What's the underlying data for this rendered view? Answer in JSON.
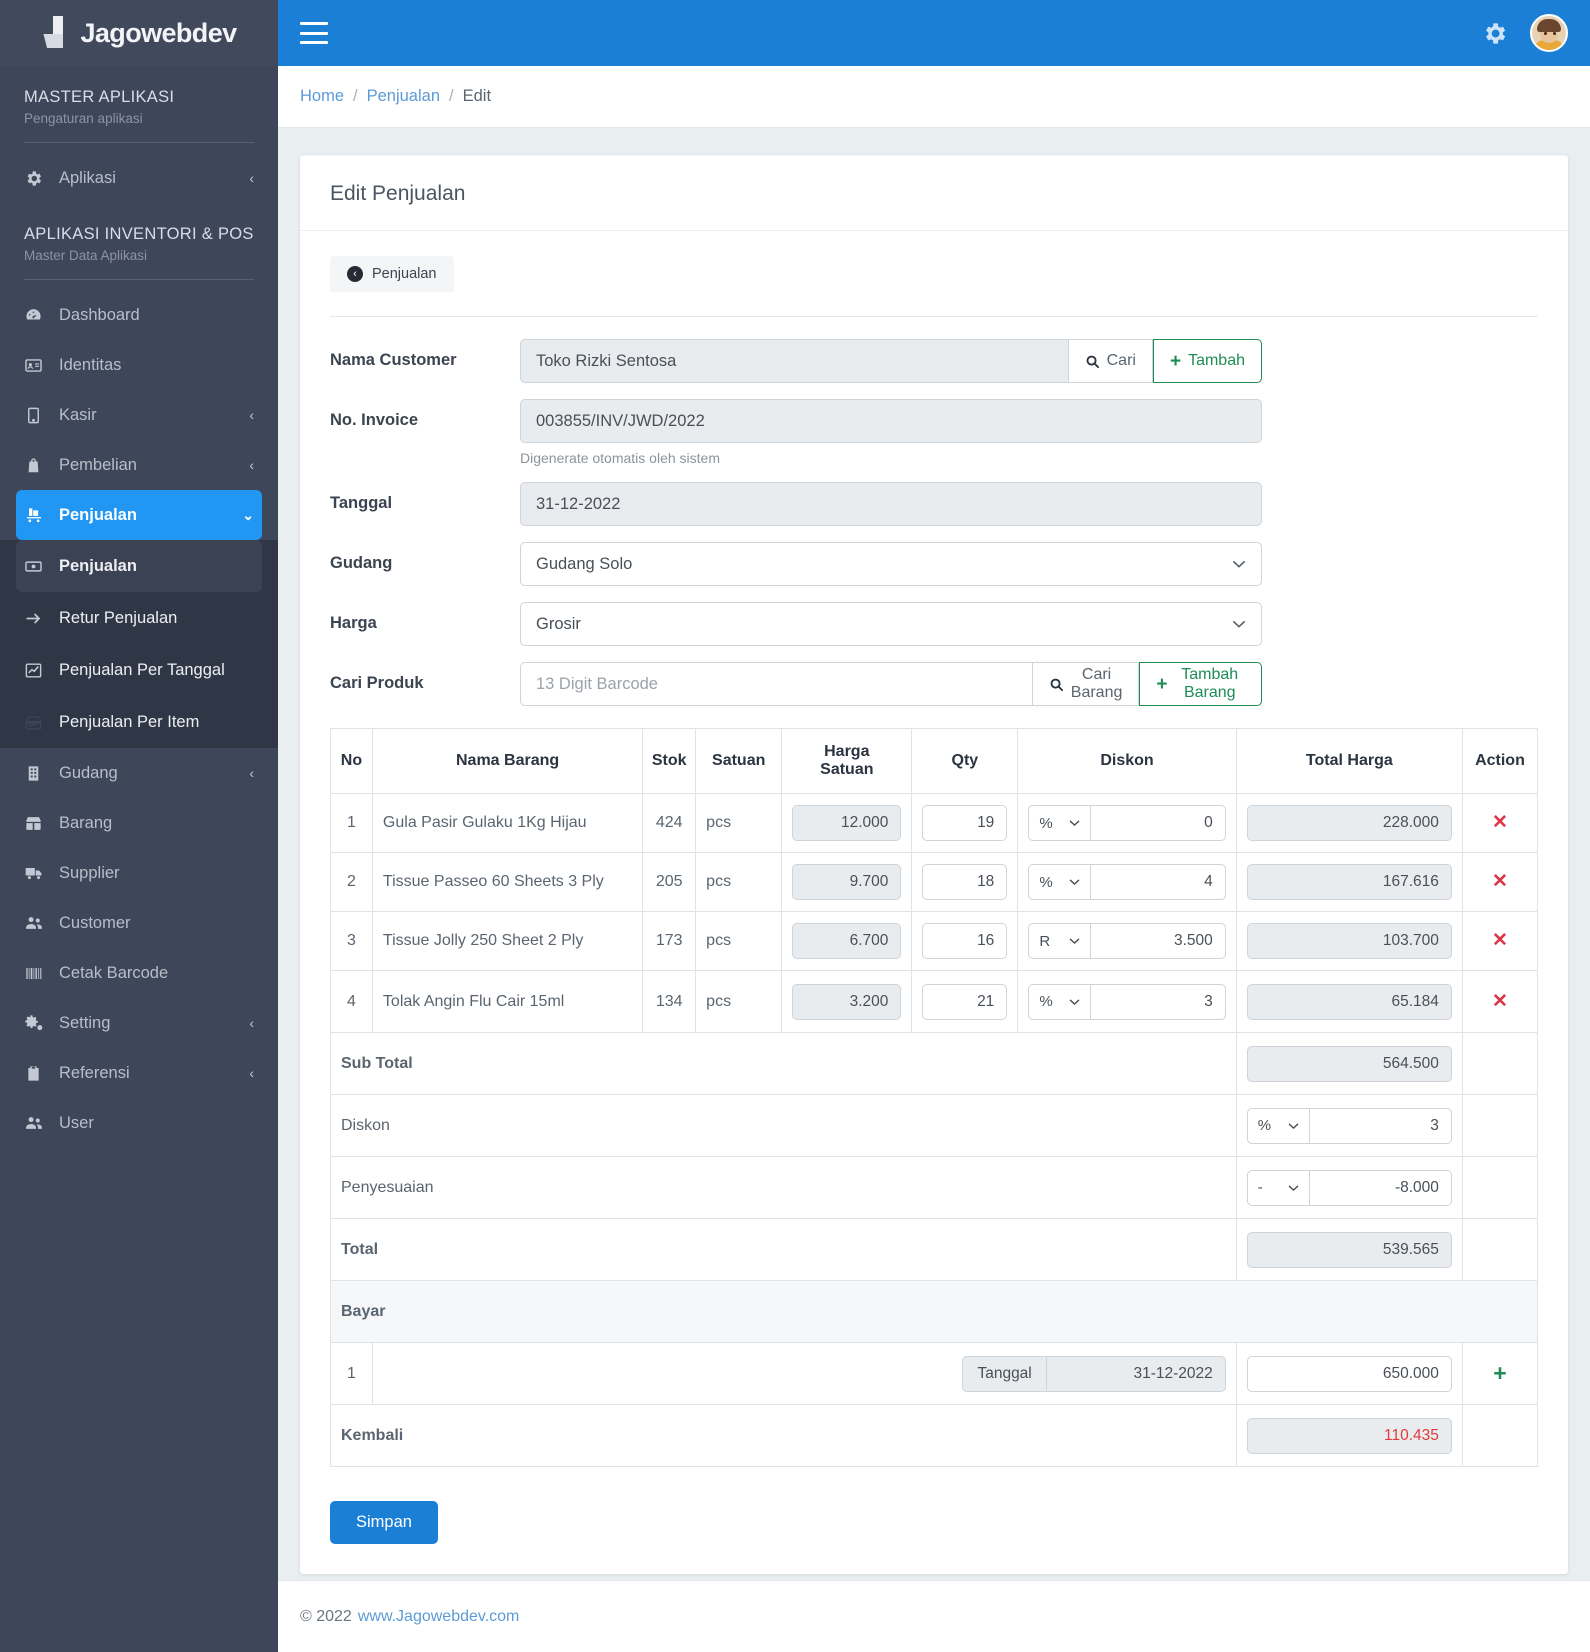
{
  "brand": {
    "name": "Jagowebdev",
    "logo_icon": "jagowebdev-logo-icon"
  },
  "topbar": {
    "menu_icon": "hamburger-icon",
    "settings_icon": "gear-icon",
    "avatar_icon": "user-avatar-icon"
  },
  "breadcrumb": {
    "home": "Home",
    "section": "Penjualan",
    "current": "Edit",
    "separator": "/"
  },
  "sidebar": {
    "sections": [
      {
        "title": "MASTER APLIKASI",
        "subtitle": "Pengaturan aplikasi"
      },
      {
        "title": "APLIKASI INVENTORI & POS",
        "subtitle": "Master Data Aplikasi"
      }
    ],
    "master_items": [
      {
        "label": "Aplikasi",
        "icon": "gear-icon",
        "caret": "‹"
      }
    ],
    "items": [
      {
        "label": "Dashboard",
        "icon": "dashboard-icon",
        "caret": ""
      },
      {
        "label": "Identitas",
        "icon": "id-card-icon",
        "caret": ""
      },
      {
        "label": "Kasir",
        "icon": "tablet-icon",
        "caret": "‹"
      },
      {
        "label": "Pembelian",
        "icon": "bag-icon",
        "caret": "‹"
      },
      {
        "label": "Penjualan",
        "icon": "cart-icon",
        "caret": "⌄",
        "active": true
      }
    ],
    "sub_items": [
      {
        "label": "Penjualan",
        "icon": "money-icon",
        "current": true
      },
      {
        "label": "Retur Penjualan",
        "icon": "arrow-right-icon"
      },
      {
        "label": "Penjualan Per Tanggal",
        "icon": "chart-line-icon"
      },
      {
        "label": "Penjualan Per Item",
        "icon": "box-chart-icon"
      }
    ],
    "items_tail": [
      {
        "label": "Gudang",
        "icon": "building-icon",
        "caret": "‹"
      },
      {
        "label": "Barang",
        "icon": "box-icon",
        "caret": ""
      },
      {
        "label": "Supplier",
        "icon": "truck-icon",
        "caret": ""
      },
      {
        "label": "Customer",
        "icon": "users-icon",
        "caret": ""
      },
      {
        "label": "Cetak Barcode",
        "icon": "barcode-icon",
        "caret": ""
      },
      {
        "label": "Setting",
        "icon": "gears-icon",
        "caret": "‹"
      },
      {
        "label": "Referensi",
        "icon": "clipboard-icon",
        "caret": "‹"
      },
      {
        "label": "User",
        "icon": "users-icon",
        "caret": ""
      }
    ]
  },
  "page": {
    "title": "Edit Penjualan",
    "back_button": "Penjualan",
    "back_icon": "arrow-left-circle-icon",
    "save_button": "Simpan"
  },
  "form": {
    "customer": {
      "label": "Nama Customer",
      "value": "Toko Rizki Sentosa",
      "search_button": "Cari",
      "search_icon": "search-icon",
      "add_button": "Tambah",
      "add_icon": "plus-icon"
    },
    "invoice": {
      "label": "No. Invoice",
      "value": "003855/INV/JWD/2022",
      "hint": "Digenerate otomatis oleh sistem"
    },
    "tanggal": {
      "label": "Tanggal",
      "value": "31-12-2022"
    },
    "gudang": {
      "label": "Gudang",
      "value": "Gudang Solo",
      "options": [
        "Gudang Solo"
      ]
    },
    "harga": {
      "label": "Harga",
      "value": "Grosir",
      "options": [
        "Grosir"
      ]
    },
    "cari_produk": {
      "label": "Cari Produk",
      "placeholder": "13 Digit Barcode",
      "value": "",
      "search_button": "Cari Barang",
      "search_icon": "search-icon",
      "add_button": "Tambah Barang",
      "add_icon": "plus-icon"
    }
  },
  "table": {
    "headers": [
      "No",
      "Nama Barang",
      "Stok",
      "Satuan",
      "Harga Satuan",
      "Qty",
      "Diskon",
      "Total Harga",
      "Action"
    ],
    "header_harga_line1": "Harga",
    "header_harga_line2": "Satuan",
    "delete_icon": "close-x-icon",
    "add_icon": "plus-icon",
    "rows": [
      {
        "no": "1",
        "nama": "Gula Pasir Gulaku 1Kg Hijau",
        "stok": "424",
        "satuan": "pcs",
        "harga": "12.000",
        "qty": "19",
        "diskon_type": "%",
        "diskon": "0",
        "total": "228.000"
      },
      {
        "no": "2",
        "nama": "Tissue Passeo 60 Sheets 3 Ply",
        "stok": "205",
        "satuan": "pcs",
        "harga": "9.700",
        "qty": "18",
        "diskon_type": "%",
        "diskon": "4",
        "total": "167.616"
      },
      {
        "no": "3",
        "nama": "Tissue Jolly 250 Sheet 2 Ply",
        "stok": "173",
        "satuan": "pcs",
        "harga": "6.700",
        "qty": "16",
        "diskon_type": "R",
        "diskon": "3.500",
        "total": "103.700"
      },
      {
        "no": "4",
        "nama": "Tolak Angin Flu Cair 15ml",
        "stok": "134",
        "satuan": "pcs",
        "harga": "3.200",
        "qty": "21",
        "diskon_type": "%",
        "diskon": "3",
        "total": "65.184"
      }
    ],
    "summary": {
      "subtotal_label": "Sub Total",
      "subtotal_value": "564.500",
      "diskon_label": "Diskon",
      "diskon_type": "%",
      "diskon_value": "3",
      "penyesuaian_label": "Penyesuaian",
      "penyesuaian_type": "-",
      "penyesuaian_value": "-8.000",
      "total_label": "Total",
      "total_value": "539.565",
      "bayar_label": "Bayar",
      "bayar_no": "1",
      "bayar_tanggal_label": "Tanggal",
      "bayar_tanggal_value": "31-12-2022",
      "bayar_value": "650.000",
      "kembali_label": "Kembali",
      "kembali_value": "110.435"
    },
    "diskon_options": [
      "%",
      "R"
    ],
    "penyesuaian_options": [
      "-",
      "+"
    ]
  },
  "footer": {
    "copyright": "© 2022",
    "link": "www.Jagowebdev.com"
  },
  "colors": {
    "accent": "#1c7fd6",
    "sidebar": "#3e4759",
    "active": "#2196f3",
    "green": "#1e8c54",
    "danger": "#dc3545",
    "kembali": "#e03b3b"
  }
}
